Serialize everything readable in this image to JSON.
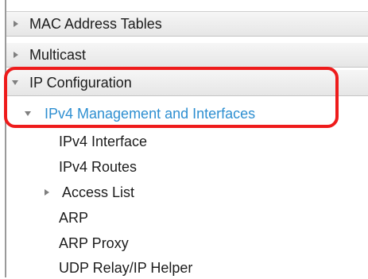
{
  "nav": {
    "items": [
      {
        "label": "MAC Address Tables"
      },
      {
        "label": "Multicast"
      },
      {
        "label": "IP Configuration"
      },
      {
        "label": "IPv4 Management and Interfaces"
      },
      {
        "label": "IPv4 Interface"
      },
      {
        "label": "IPv4 Routes"
      },
      {
        "label": "Access List"
      },
      {
        "label": "ARP"
      },
      {
        "label": "ARP Proxy"
      },
      {
        "label": "UDP Relay/IP Helper"
      }
    ]
  },
  "colors": {
    "active_link": "#2e8fd1",
    "highlight_outline": "#ee1b1b",
    "header_bg": "#ececec"
  }
}
